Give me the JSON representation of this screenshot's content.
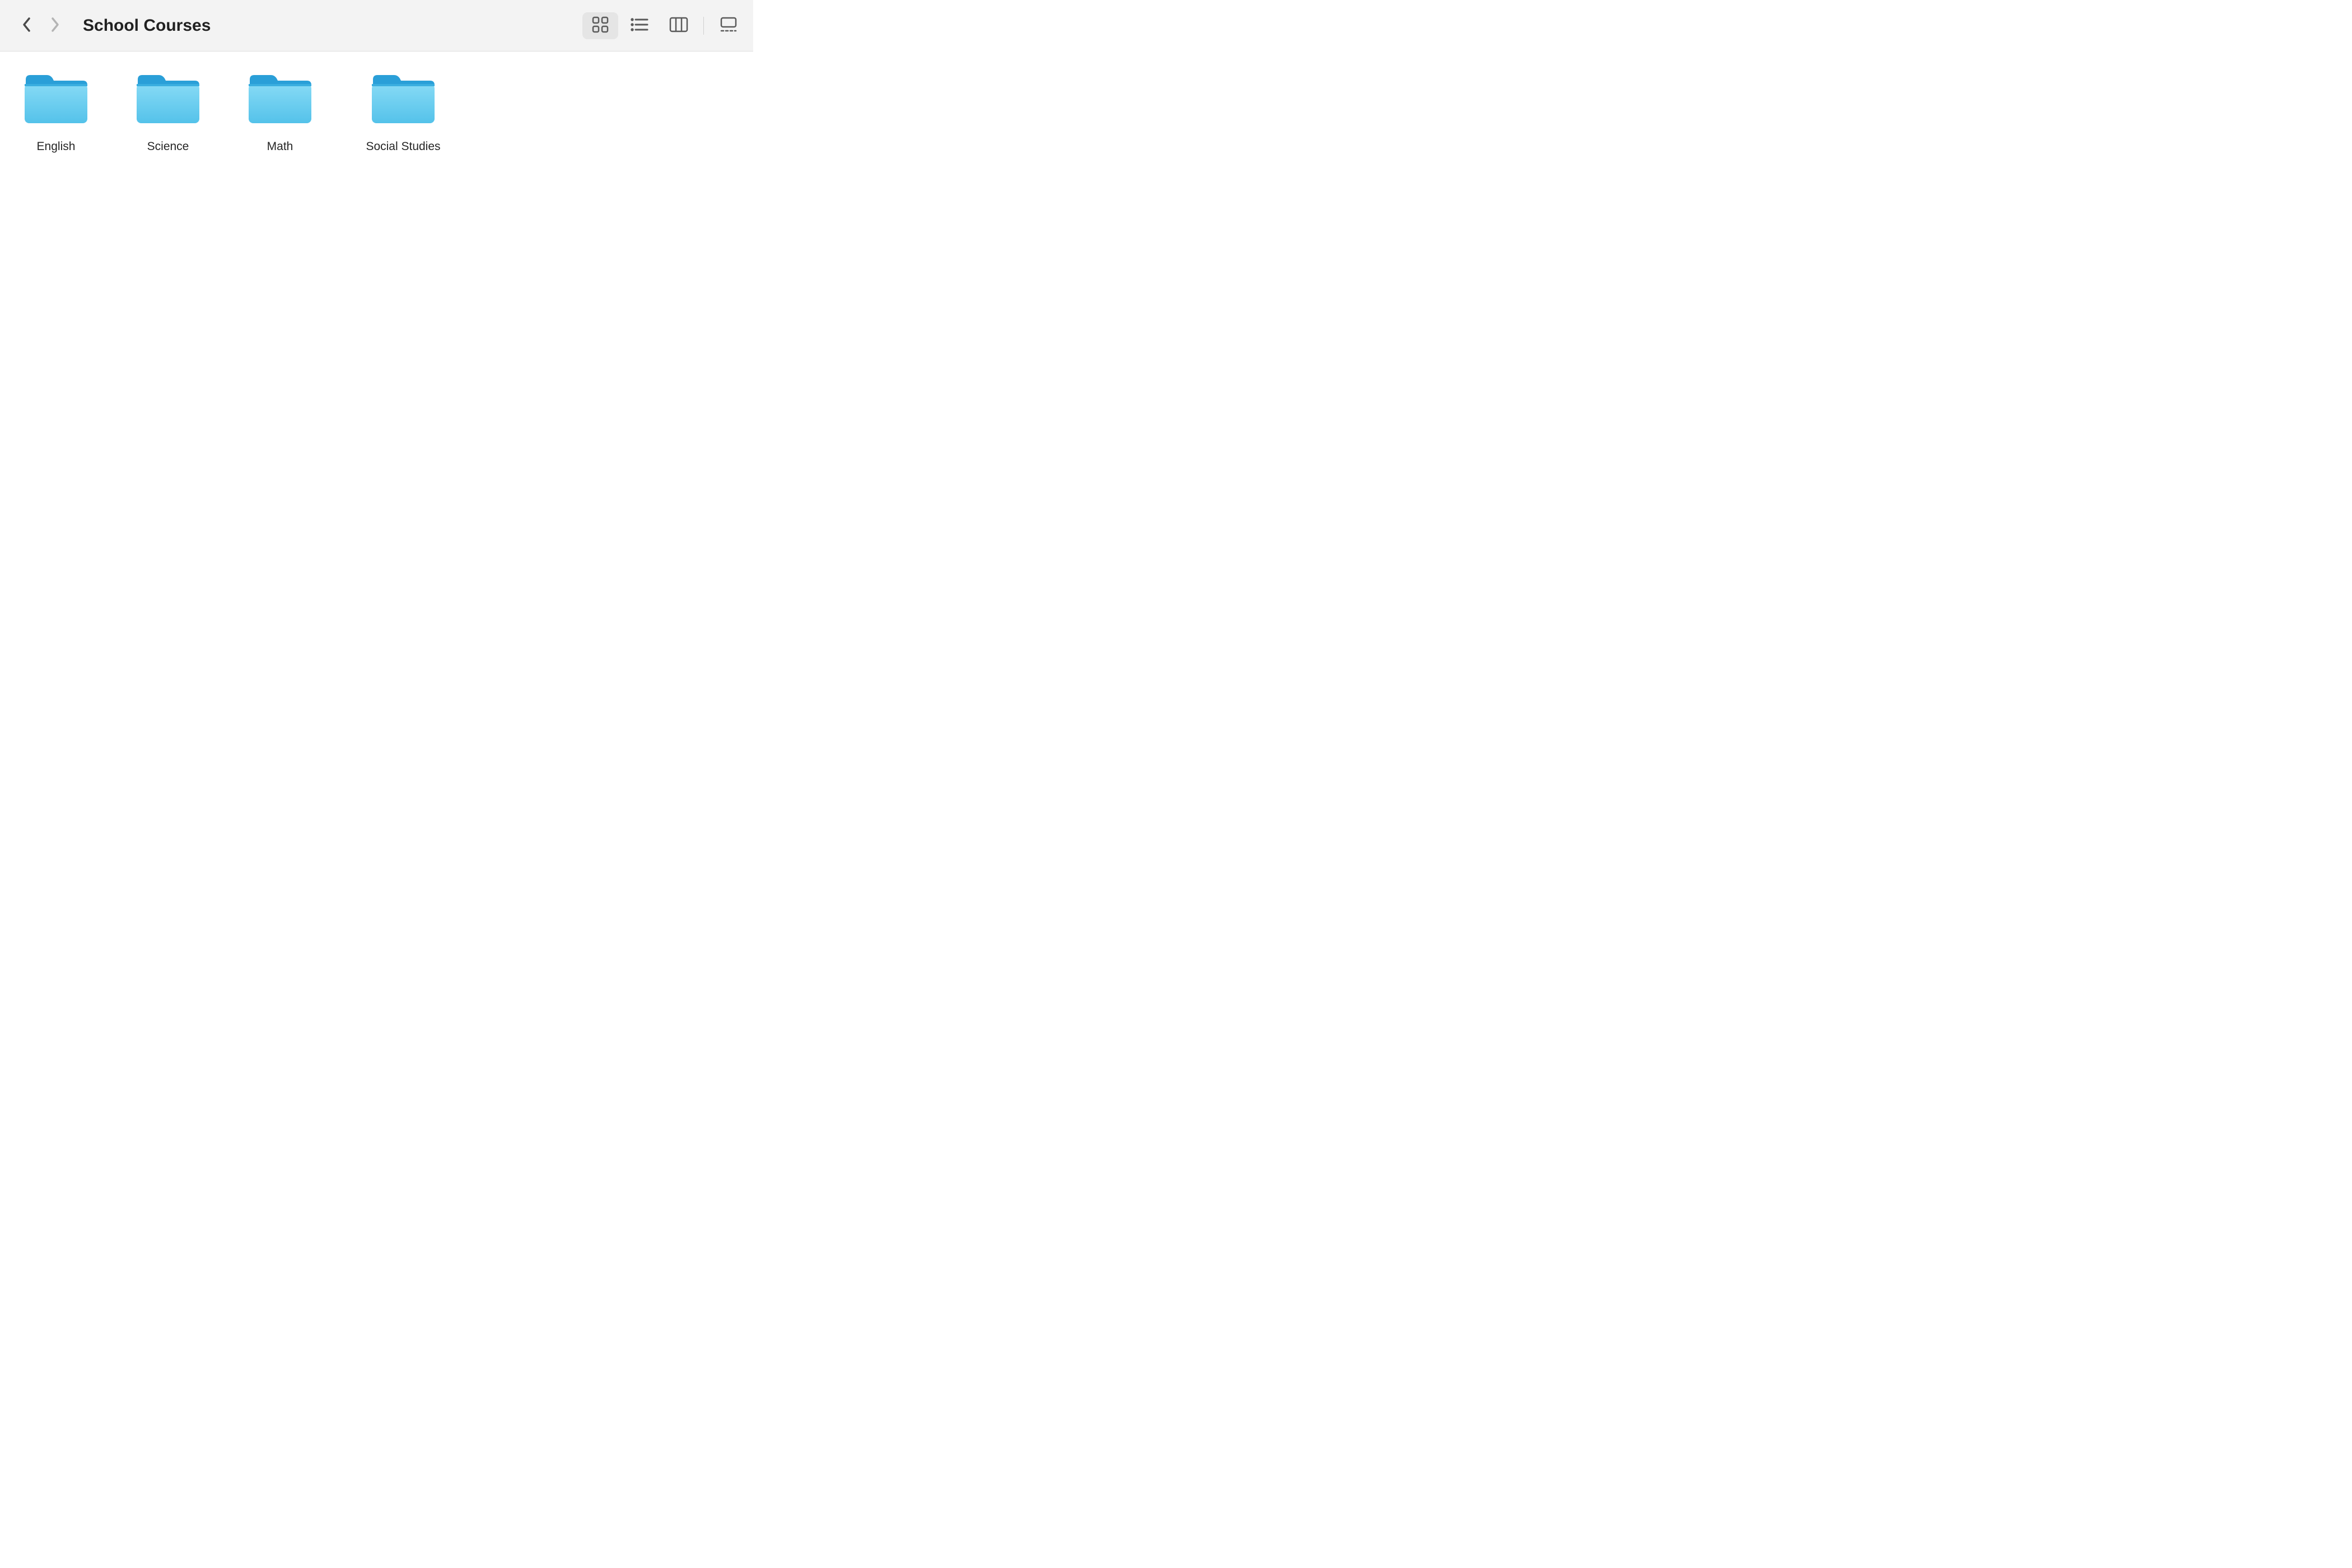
{
  "header": {
    "title": "School Courses"
  },
  "view_modes": {
    "icon": "icon-view",
    "list": "list-view",
    "column": "column-view",
    "gallery": "gallery-view",
    "active": "icon"
  },
  "folders": [
    {
      "name": "English"
    },
    {
      "name": "Science"
    },
    {
      "name": "Math"
    },
    {
      "name": "Social Studies"
    }
  ],
  "colors": {
    "folder_top": "#2a9fd8",
    "folder_body_light": "#79d3f2",
    "folder_body_dark": "#54c2ea"
  }
}
